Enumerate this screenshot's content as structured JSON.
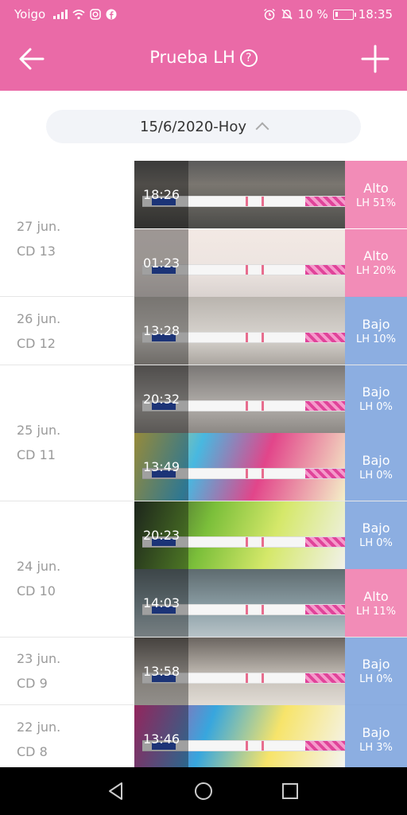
{
  "status_bar": {
    "carrier": "Yoigo",
    "battery_text": "10 %",
    "time": "18:35",
    "icons": [
      "signal-icon",
      "wifi-icon",
      "instagram-icon",
      "facebook-icon",
      "alarm-icon",
      "mute-icon",
      "battery-icon"
    ]
  },
  "header": {
    "title": "Prueba LH",
    "help_glyph": "?",
    "back_icon": "arrow-left-icon",
    "add_icon": "plus-icon"
  },
  "date_filter": {
    "label": "15/6/2020-Hoy",
    "icon": "chevron-up-icon"
  },
  "colors": {
    "brand": "#ea6aa7",
    "high": "#f078aa",
    "low": "#78a0dc"
  },
  "days": [
    {
      "date": "27 jun.",
      "cd": "CD 13",
      "entries": [
        {
          "time": "18:26",
          "level": "Alto",
          "lh": "LH 51%",
          "tone": "high"
        },
        {
          "time": "01:23",
          "level": "Alto",
          "lh": "LH 20%",
          "tone": "high"
        }
      ]
    },
    {
      "date": "26 jun.",
      "cd": "CD 12",
      "entries": [
        {
          "time": "13:28",
          "level": "Bajo",
          "lh": "LH 10%",
          "tone": "low"
        }
      ]
    },
    {
      "date": "25 jun.",
      "cd": "CD 11",
      "entries": [
        {
          "time": "20:32",
          "level": "Bajo",
          "lh": "LH 0%",
          "tone": "low"
        },
        {
          "time": "13:49",
          "level": "Bajo",
          "lh": "LH 0%",
          "tone": "low"
        }
      ]
    },
    {
      "date": "24 jun.",
      "cd": "CD 10",
      "entries": [
        {
          "time": "20:23",
          "level": "Bajo",
          "lh": "LH 0%",
          "tone": "low"
        },
        {
          "time": "14:03",
          "level": "Alto",
          "lh": "LH 11%",
          "tone": "high"
        }
      ]
    },
    {
      "date": "23 jun.",
      "cd": "CD 9",
      "entries": [
        {
          "time": "13:58",
          "level": "Bajo",
          "lh": "LH 0%",
          "tone": "low"
        }
      ]
    },
    {
      "date": "22 jun.",
      "cd": "CD 8",
      "entries": [
        {
          "time": "13:46",
          "level": "Bajo",
          "lh": "LH 3%",
          "tone": "low"
        }
      ]
    }
  ],
  "nav_bar": {
    "icons": [
      "back-triangle-icon",
      "home-circle-icon",
      "recents-square-icon"
    ]
  }
}
